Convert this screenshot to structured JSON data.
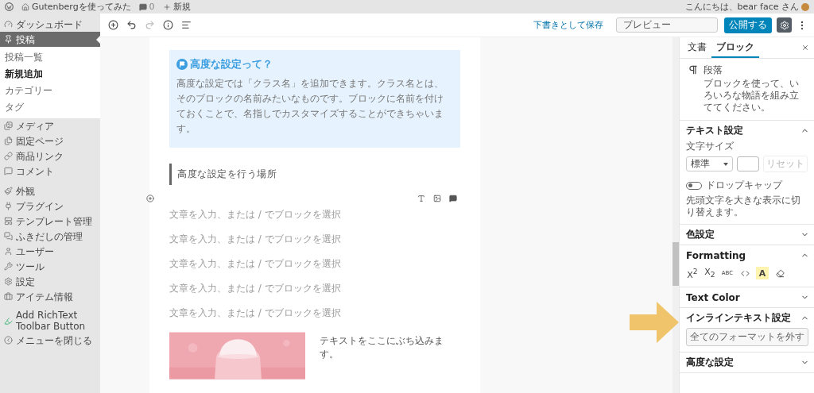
{
  "admin_bar": {
    "site": "Gutenbergを使ってみた",
    "comments": "0",
    "new": "新規",
    "greeting": "こんにちは、bear face さん"
  },
  "menu": {
    "groups": [
      {
        "items": [
          {
            "label": "ダッシュボード",
            "selected": false
          },
          {
            "label": "投稿",
            "selected": true,
            "children": [
              {
                "label": "投稿一覧",
                "selected": false
              },
              {
                "label": "新規追加",
                "selected": true
              },
              {
                "label": "カテゴリー",
                "selected": false
              },
              {
                "label": "タグ",
                "selected": false
              }
            ]
          },
          {
            "label": "メディア",
            "selected": false
          },
          {
            "label": "固定ページ",
            "selected": false
          },
          {
            "label": "商品リンク",
            "selected": false
          },
          {
            "label": "コメント",
            "selected": false
          }
        ]
      },
      {
        "items": [
          {
            "label": "外観",
            "selected": false
          },
          {
            "label": "プラグイン",
            "selected": false
          },
          {
            "label": "テンプレート管理",
            "selected": false
          },
          {
            "label": "ふきだしの管理",
            "selected": false
          },
          {
            "label": "ユーザー",
            "selected": false
          },
          {
            "label": "ツール",
            "selected": false
          },
          {
            "label": "設定",
            "selected": false
          },
          {
            "label": "アイテム情報",
            "selected": false
          }
        ]
      },
      {
        "items": [
          {
            "label": "Add RichText Toolbar Button",
            "selected": false
          },
          {
            "label": "メニューを閉じる",
            "selected": false
          }
        ]
      }
    ]
  },
  "header": {
    "tools": [
      {
        "kind": "add",
        "disabled": false
      },
      {
        "kind": "undo",
        "disabled": false
      },
      {
        "kind": "redo",
        "disabled": true
      },
      {
        "kind": "info",
        "disabled": false
      },
      {
        "kind": "outline",
        "disabled": false
      }
    ],
    "save_draft": "下書きとして保存",
    "preview": "プレビュー",
    "publish": "公開する"
  },
  "editor": {
    "info_box": {
      "title": "高度な設定って？",
      "body": "高度な設定では「クラス名」を追加できます。クラス名とは、そのブロックの名前みたいなものです。ブロックに名前を付けておくことで、名指しでカスタマイズすることができちゃいます。"
    },
    "heading": "高度な設定を行う場所",
    "paragraphs": [
      {
        "placeholder": "文章を入力、または / でブロックを選択"
      },
      {
        "placeholder": "文章を入力、または / でブロックを選択"
      },
      {
        "placeholder": "文章を入力、または / でブロックを選択"
      },
      {
        "placeholder": "文章を入力、または / でブロックを選択"
      },
      {
        "placeholder": "文章を入力、または / でブロックを選択"
      }
    ],
    "media_text": {
      "text": "テキストをここにぶち込みます。"
    }
  },
  "settings": {
    "tabs": [
      {
        "label": "文書",
        "selected": false
      },
      {
        "label": "ブロック",
        "selected": true
      }
    ],
    "block": {
      "name": "段落",
      "description": "ブロックを使って、いろいろな物語を組み立ててください。"
    },
    "panels": [
      {
        "kind": "text_settings",
        "title": "テキスト設定",
        "expanded": true,
        "font_size_label": "文字サイズ",
        "font_size": "標準",
        "reset": "リセット",
        "reset_disabled": true,
        "drop_cap": {
          "label": "ドロップキャップ",
          "on": false,
          "help": "先頭文字を大きな表示に切り替えます。"
        }
      },
      {
        "kind": "plain",
        "title": "色設定",
        "expanded": false
      },
      {
        "kind": "formatting",
        "title": "Formatting",
        "expanded": true,
        "buttons": [
          {
            "kind": "text",
            "label": "X$^{2}$",
            "active": false
          },
          {
            "kind": "text",
            "label": "X$_{2}$",
            "active": false
          },
          {
            "kind": "text",
            "label": "ABC",
            "active": false
          },
          {
            "kind": "code",
            "active": false
          },
          {
            "kind": "text",
            "label": "A",
            "active": true
          },
          {
            "kind": "eraser",
            "active": false
          }
        ]
      },
      {
        "kind": "plain",
        "title": "Text Color",
        "expanded": false
      },
      {
        "kind": "inline",
        "title": "インラインテキスト設定",
        "expanded": true,
        "button": "全てのフォーマットを外す"
      },
      {
        "kind": "plain",
        "title": "高度な設定",
        "expanded": false
      }
    ]
  }
}
